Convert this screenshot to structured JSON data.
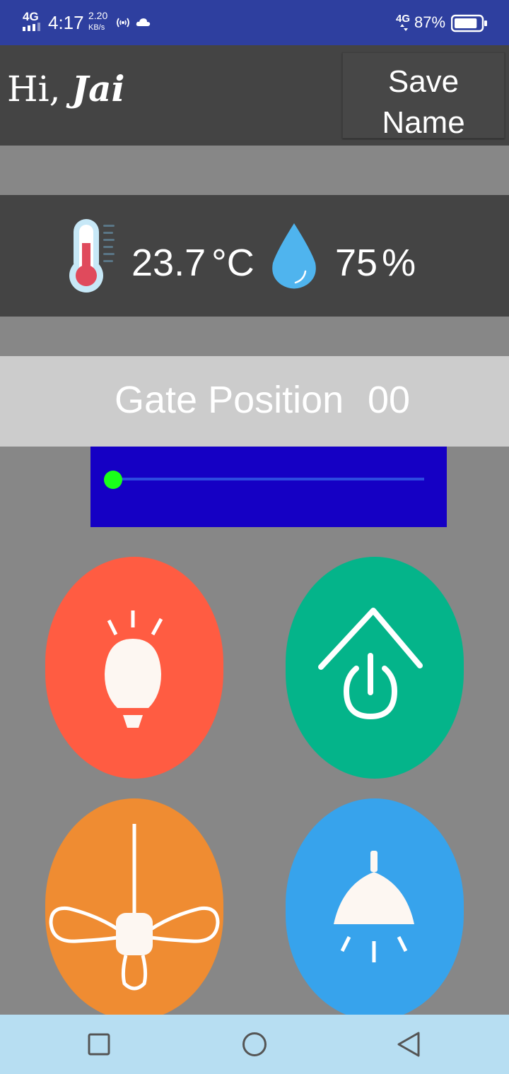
{
  "status_bar": {
    "network": "4G",
    "time": "4:17",
    "speed_value": "2.20",
    "speed_unit": "KB/s",
    "network_right": "4G",
    "battery": "87%",
    "battery_level": 0.87
  },
  "header": {
    "greeting": "Hi,",
    "user_name": "Jai",
    "save_button_line1": "Save",
    "save_button_line2": "Name"
  },
  "climate": {
    "temperature_value": "23.7",
    "temperature_unit": "°C",
    "humidity_value": "75",
    "humidity_unit": "%"
  },
  "gate": {
    "label": "Gate Position",
    "value": "00",
    "slider_fraction": 0
  },
  "tiles": [
    {
      "icon": "light-bulb-icon",
      "color": "#ff5c42"
    },
    {
      "icon": "home-power-icon",
      "color": "#04b48a"
    },
    {
      "icon": "ceiling-fan-icon",
      "color": "#ef8c32"
    },
    {
      "icon": "pendant-lamp-icon",
      "color": "#37a3ec"
    }
  ],
  "nav": {
    "buttons": [
      "recent-apps-icon",
      "home-icon",
      "back-icon"
    ]
  },
  "colors": {
    "status_bar": "#2e3f9f",
    "header": "#444444",
    "background": "#878787",
    "gate_bar": "#cccccc",
    "slider_box": "#1500c4",
    "slider_thumb": "#19ff19",
    "nav_bar": "#b7def2"
  }
}
